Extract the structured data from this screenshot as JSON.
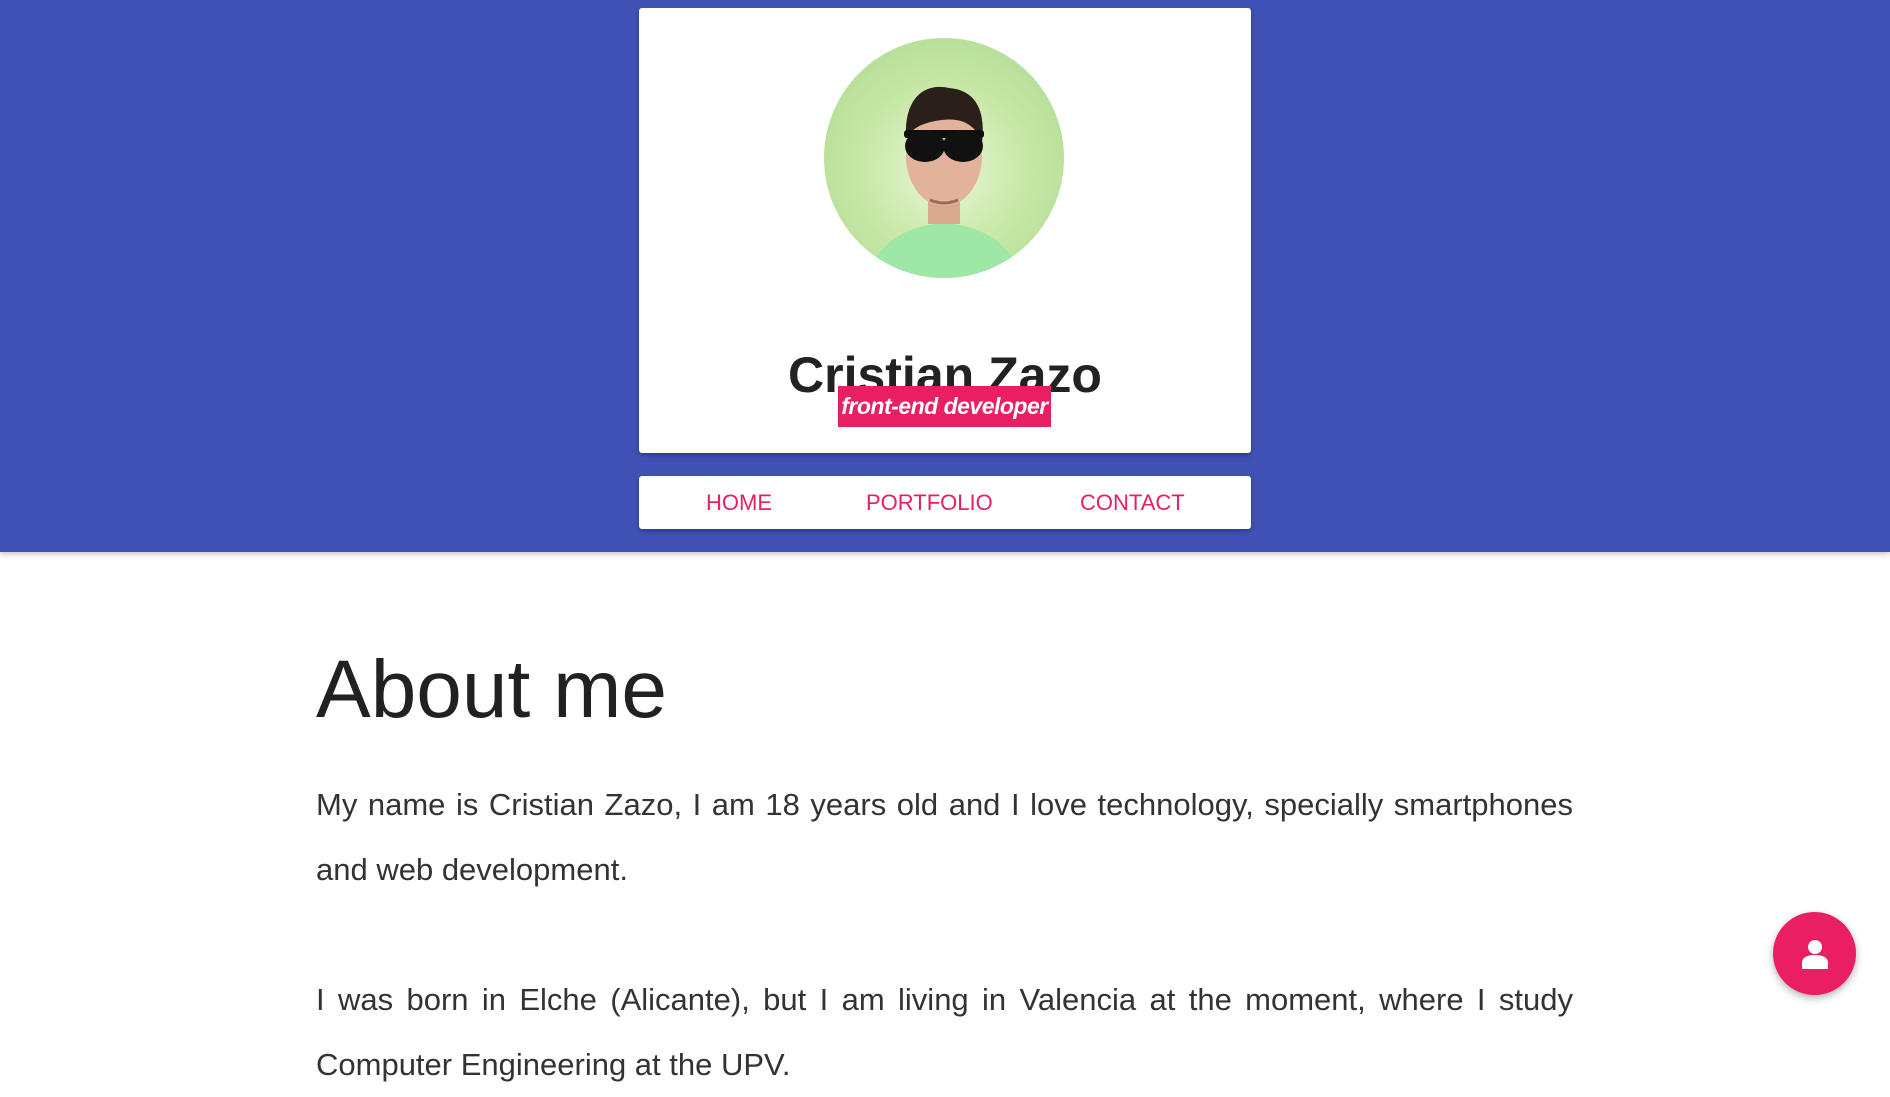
{
  "profile": {
    "name": "Cristian Zazo",
    "role": "front-end developer",
    "avatar_icon": "profile-photo"
  },
  "nav": {
    "items": [
      {
        "label": "HOME"
      },
      {
        "label": "PORTFOLIO"
      },
      {
        "label": "CONTACT"
      }
    ]
  },
  "about": {
    "title": "About me",
    "paragraphs": [
      "My name is Cristian Zazo, I am 18 years old and I love technology, specially smartphones and web development.",
      "I was born in Elche (Alicante), but I am living in Valencia at the moment, where I study Computer Engineering at the UPV."
    ]
  },
  "fab": {
    "icon": "person-icon"
  },
  "colors": {
    "primary": "#3f51b5",
    "accent": "#e91e63",
    "card": "#ffffff",
    "text": "#212121"
  }
}
